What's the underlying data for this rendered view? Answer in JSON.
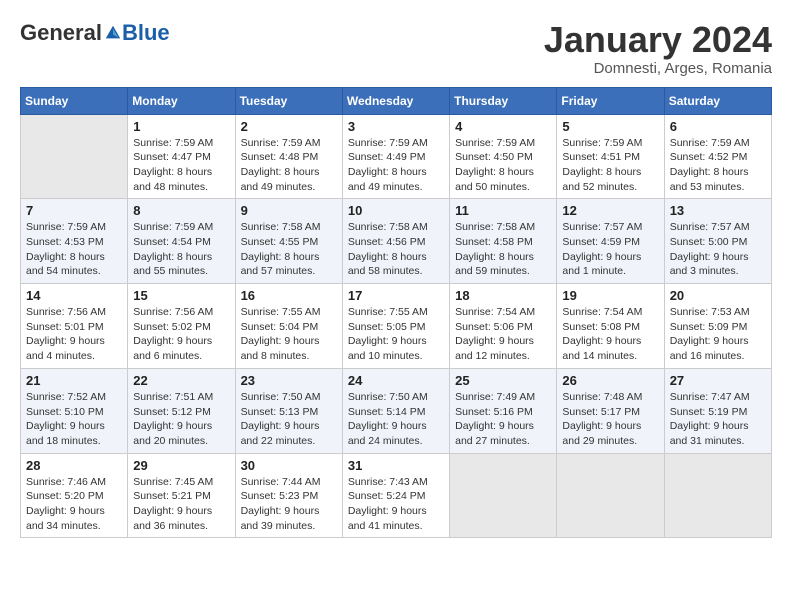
{
  "header": {
    "logo_general": "General",
    "logo_blue": "Blue",
    "month_title": "January 2024",
    "subtitle": "Domnesti, Arges, Romania"
  },
  "weekdays": [
    "Sunday",
    "Monday",
    "Tuesday",
    "Wednesday",
    "Thursday",
    "Friday",
    "Saturday"
  ],
  "weeks": [
    [
      {
        "day": "",
        "info": ""
      },
      {
        "day": "1",
        "info": "Sunrise: 7:59 AM\nSunset: 4:47 PM\nDaylight: 8 hours\nand 48 minutes."
      },
      {
        "day": "2",
        "info": "Sunrise: 7:59 AM\nSunset: 4:48 PM\nDaylight: 8 hours\nand 49 minutes."
      },
      {
        "day": "3",
        "info": "Sunrise: 7:59 AM\nSunset: 4:49 PM\nDaylight: 8 hours\nand 49 minutes."
      },
      {
        "day": "4",
        "info": "Sunrise: 7:59 AM\nSunset: 4:50 PM\nDaylight: 8 hours\nand 50 minutes."
      },
      {
        "day": "5",
        "info": "Sunrise: 7:59 AM\nSunset: 4:51 PM\nDaylight: 8 hours\nand 52 minutes."
      },
      {
        "day": "6",
        "info": "Sunrise: 7:59 AM\nSunset: 4:52 PM\nDaylight: 8 hours\nand 53 minutes."
      }
    ],
    [
      {
        "day": "7",
        "info": "Sunrise: 7:59 AM\nSunset: 4:53 PM\nDaylight: 8 hours\nand 54 minutes."
      },
      {
        "day": "8",
        "info": "Sunrise: 7:59 AM\nSunset: 4:54 PM\nDaylight: 8 hours\nand 55 minutes."
      },
      {
        "day": "9",
        "info": "Sunrise: 7:58 AM\nSunset: 4:55 PM\nDaylight: 8 hours\nand 57 minutes."
      },
      {
        "day": "10",
        "info": "Sunrise: 7:58 AM\nSunset: 4:56 PM\nDaylight: 8 hours\nand 58 minutes."
      },
      {
        "day": "11",
        "info": "Sunrise: 7:58 AM\nSunset: 4:58 PM\nDaylight: 8 hours\nand 59 minutes."
      },
      {
        "day": "12",
        "info": "Sunrise: 7:57 AM\nSunset: 4:59 PM\nDaylight: 9 hours\nand 1 minute."
      },
      {
        "day": "13",
        "info": "Sunrise: 7:57 AM\nSunset: 5:00 PM\nDaylight: 9 hours\nand 3 minutes."
      }
    ],
    [
      {
        "day": "14",
        "info": "Sunrise: 7:56 AM\nSunset: 5:01 PM\nDaylight: 9 hours\nand 4 minutes."
      },
      {
        "day": "15",
        "info": "Sunrise: 7:56 AM\nSunset: 5:02 PM\nDaylight: 9 hours\nand 6 minutes."
      },
      {
        "day": "16",
        "info": "Sunrise: 7:55 AM\nSunset: 5:04 PM\nDaylight: 9 hours\nand 8 minutes."
      },
      {
        "day": "17",
        "info": "Sunrise: 7:55 AM\nSunset: 5:05 PM\nDaylight: 9 hours\nand 10 minutes."
      },
      {
        "day": "18",
        "info": "Sunrise: 7:54 AM\nSunset: 5:06 PM\nDaylight: 9 hours\nand 12 minutes."
      },
      {
        "day": "19",
        "info": "Sunrise: 7:54 AM\nSunset: 5:08 PM\nDaylight: 9 hours\nand 14 minutes."
      },
      {
        "day": "20",
        "info": "Sunrise: 7:53 AM\nSunset: 5:09 PM\nDaylight: 9 hours\nand 16 minutes."
      }
    ],
    [
      {
        "day": "21",
        "info": "Sunrise: 7:52 AM\nSunset: 5:10 PM\nDaylight: 9 hours\nand 18 minutes."
      },
      {
        "day": "22",
        "info": "Sunrise: 7:51 AM\nSunset: 5:12 PM\nDaylight: 9 hours\nand 20 minutes."
      },
      {
        "day": "23",
        "info": "Sunrise: 7:50 AM\nSunset: 5:13 PM\nDaylight: 9 hours\nand 22 minutes."
      },
      {
        "day": "24",
        "info": "Sunrise: 7:50 AM\nSunset: 5:14 PM\nDaylight: 9 hours\nand 24 minutes."
      },
      {
        "day": "25",
        "info": "Sunrise: 7:49 AM\nSunset: 5:16 PM\nDaylight: 9 hours\nand 27 minutes."
      },
      {
        "day": "26",
        "info": "Sunrise: 7:48 AM\nSunset: 5:17 PM\nDaylight: 9 hours\nand 29 minutes."
      },
      {
        "day": "27",
        "info": "Sunrise: 7:47 AM\nSunset: 5:19 PM\nDaylight: 9 hours\nand 31 minutes."
      }
    ],
    [
      {
        "day": "28",
        "info": "Sunrise: 7:46 AM\nSunset: 5:20 PM\nDaylight: 9 hours\nand 34 minutes."
      },
      {
        "day": "29",
        "info": "Sunrise: 7:45 AM\nSunset: 5:21 PM\nDaylight: 9 hours\nand 36 minutes."
      },
      {
        "day": "30",
        "info": "Sunrise: 7:44 AM\nSunset: 5:23 PM\nDaylight: 9 hours\nand 39 minutes."
      },
      {
        "day": "31",
        "info": "Sunrise: 7:43 AM\nSunset: 5:24 PM\nDaylight: 9 hours\nand 41 minutes."
      },
      {
        "day": "",
        "info": ""
      },
      {
        "day": "",
        "info": ""
      },
      {
        "day": "",
        "info": ""
      }
    ]
  ]
}
